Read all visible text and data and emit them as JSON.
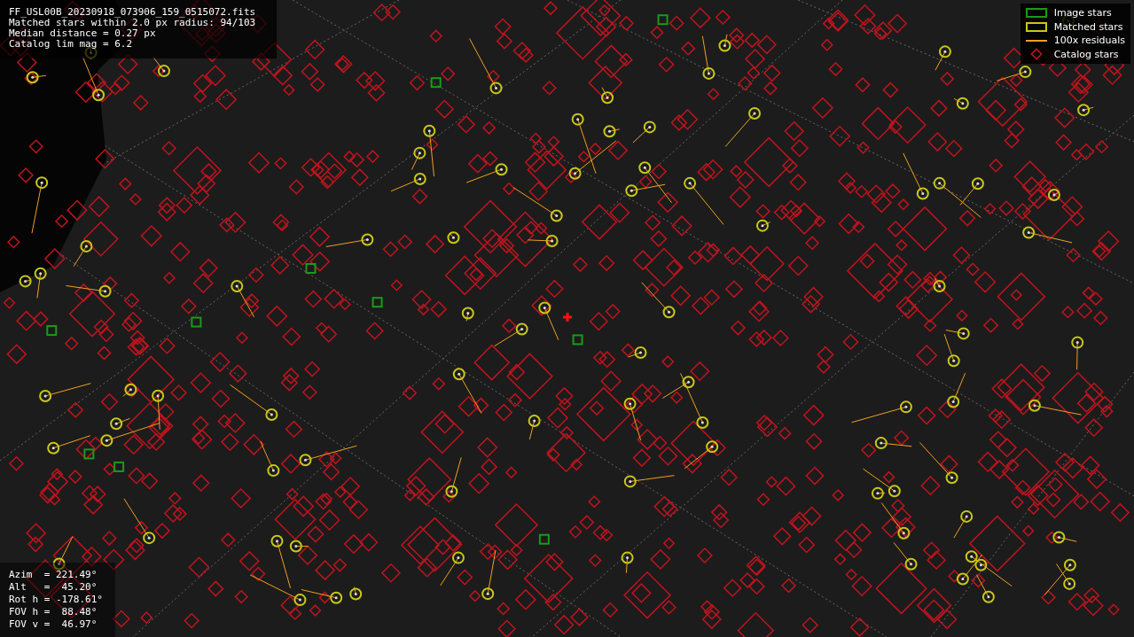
{
  "info_panel": {
    "lines": [
      "FF_USL00B_20230918_073906_159_0515072.fits",
      "Matched stars within 2.0 px radius: 94/103",
      "Median distance = 0.27 px",
      "Catalog lim mag = 6.2"
    ]
  },
  "legend": [
    {
      "kind": "image",
      "label": "Image stars"
    },
    {
      "kind": "matched",
      "label": "Matched stars"
    },
    {
      "kind": "residual",
      "label": "100x residuals"
    },
    {
      "kind": "catalog",
      "label": "Catalog stars"
    }
  ],
  "pointing_panel": {
    "lines": [
      "Azim  = 221.49°",
      "Alt   =  45.20°",
      "Rot h = -178.61°",
      "FOV h =  88.48°",
      "FOV v =  46.97°"
    ]
  }
}
